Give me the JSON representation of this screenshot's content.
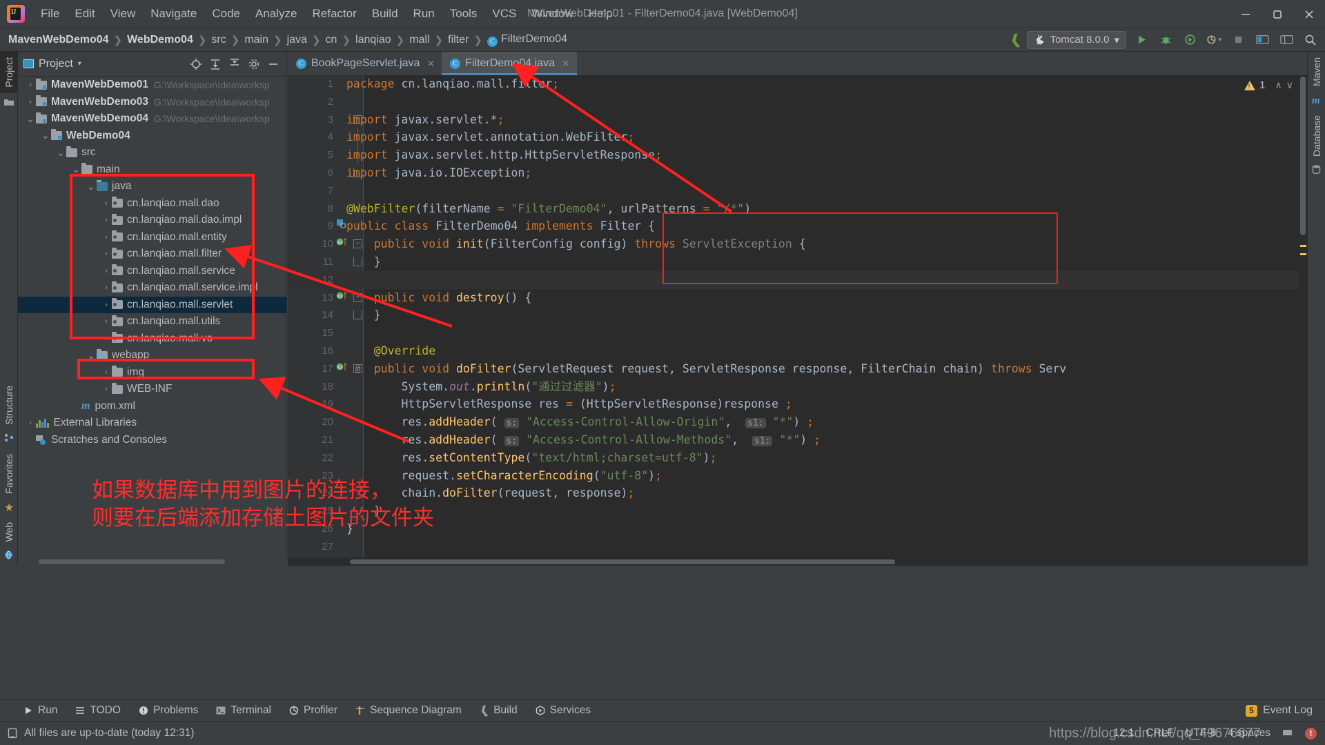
{
  "titlebar": {
    "window_title": "MavenWebDemo01 - FilterDemo04.java [WebDemo04]",
    "menus": [
      "File",
      "Edit",
      "View",
      "Navigate",
      "Code",
      "Analyze",
      "Refactor",
      "Build",
      "Run",
      "Tools",
      "VCS",
      "Window",
      "Help"
    ],
    "minimize_label": "—",
    "maximize_label": "❐",
    "close_label": "✕"
  },
  "navbar": {
    "crumbs": [
      "MavenWebDemo04",
      "WebDemo04",
      "src",
      "main",
      "java",
      "cn",
      "lanqiao",
      "mall",
      "filter",
      "FilterDemo04"
    ],
    "class_icon_letter": "C",
    "run_config": "Tomcat 8.0.0",
    "run_config_caret": "▾"
  },
  "left_strip": {
    "top_tabs": [
      "Project"
    ],
    "bottom_tabs": [
      "Structure",
      "Favorites",
      "Web"
    ]
  },
  "right_strip": {
    "tabs": [
      "Maven",
      "Database"
    ]
  },
  "project_panel": {
    "title": "Project",
    "caret": "▾",
    "tree": [
      {
        "depth": 0,
        "arrow": "›",
        "icon": "module",
        "label": "MavenWebDemo01",
        "bold": true,
        "path": "G:\\Workspace\\Idea\\worksp",
        "selected": false
      },
      {
        "depth": 0,
        "arrow": "›",
        "icon": "module",
        "label": "MavenWebDemo03",
        "bold": true,
        "path": "G:\\Workspace\\Idea\\worksp",
        "selected": false
      },
      {
        "depth": 0,
        "arrow": "⌄",
        "icon": "module",
        "label": "MavenWebDemo04",
        "bold": true,
        "path": "G:\\Workspace\\Idea\\worksp",
        "selected": false
      },
      {
        "depth": 1,
        "arrow": "⌄",
        "icon": "module",
        "label": "WebDemo04",
        "bold": true,
        "path": "",
        "selected": false
      },
      {
        "depth": 2,
        "arrow": "⌄",
        "icon": "folder",
        "label": "src",
        "bold": false,
        "path": "",
        "selected": false
      },
      {
        "depth": 3,
        "arrow": "⌄",
        "icon": "folder",
        "label": "main",
        "bold": false,
        "path": "",
        "selected": false
      },
      {
        "depth": 4,
        "arrow": "⌄",
        "icon": "source",
        "label": "java",
        "bold": false,
        "path": "",
        "selected": false
      },
      {
        "depth": 5,
        "arrow": "›",
        "icon": "package",
        "label": "cn.lanqiao.mall.dao",
        "bold": false,
        "path": "",
        "selected": false
      },
      {
        "depth": 5,
        "arrow": "›",
        "icon": "package",
        "label": "cn.lanqiao.mall.dao.impl",
        "bold": false,
        "path": "",
        "selected": false
      },
      {
        "depth": 5,
        "arrow": "›",
        "icon": "package",
        "label": "cn.lanqiao.mall.entity",
        "bold": false,
        "path": "",
        "selected": false
      },
      {
        "depth": 5,
        "arrow": "›",
        "icon": "package",
        "label": "cn.lanqiao.mall.filter",
        "bold": false,
        "path": "",
        "selected": false
      },
      {
        "depth": 5,
        "arrow": "›",
        "icon": "package",
        "label": "cn.lanqiao.mall.service",
        "bold": false,
        "path": "",
        "selected": false
      },
      {
        "depth": 5,
        "arrow": "›",
        "icon": "package",
        "label": "cn.lanqiao.mall.service.impl",
        "bold": false,
        "path": "",
        "selected": false
      },
      {
        "depth": 5,
        "arrow": "›",
        "icon": "package",
        "label": "cn.lanqiao.mall.servlet",
        "bold": false,
        "path": "",
        "selected": true
      },
      {
        "depth": 5,
        "arrow": "›",
        "icon": "package",
        "label": "cn.lanqiao.mall.utils",
        "bold": false,
        "path": "",
        "selected": false
      },
      {
        "depth": 5,
        "arrow": "›",
        "icon": "package",
        "label": "cn.lanqiao.mall.vo",
        "bold": false,
        "path": "",
        "selected": false
      },
      {
        "depth": 4,
        "arrow": "⌄",
        "icon": "webapp",
        "label": "webapp",
        "bold": false,
        "path": "",
        "selected": false
      },
      {
        "depth": 5,
        "arrow": "›",
        "icon": "folder",
        "label": "img",
        "bold": false,
        "path": "",
        "selected": false
      },
      {
        "depth": 5,
        "arrow": "›",
        "icon": "folder",
        "label": "WEB-INF",
        "bold": false,
        "path": "",
        "selected": false
      },
      {
        "depth": 3,
        "arrow": "",
        "icon": "maven",
        "label": "pom.xml",
        "bold": false,
        "path": "",
        "selected": false
      },
      {
        "depth": 0,
        "arrow": "›",
        "icon": "library",
        "label": "External Libraries",
        "bold": false,
        "path": "",
        "selected": false
      },
      {
        "depth": 0,
        "arrow": "",
        "icon": "scratch",
        "label": "Scratches and Consoles",
        "bold": false,
        "path": "",
        "selected": false
      }
    ]
  },
  "editor": {
    "tabs": [
      {
        "label": "BookPageServlet.java",
        "active": false,
        "icon_letter": "C",
        "close": "✕"
      },
      {
        "label": "FilterDemo04.java",
        "active": true,
        "icon_letter": "C",
        "close": "✕"
      }
    ],
    "warning_count": "1",
    "warning_up": "∧",
    "warning_down": "∨",
    "lines": [
      {
        "n": "1",
        "text": "package cn.lanqiao.mall.filter;"
      },
      {
        "n": "2",
        "text": ""
      },
      {
        "n": "3",
        "text": "import javax.servlet.*;"
      },
      {
        "n": "4",
        "text": "import javax.servlet.annotation.WebFilter;"
      },
      {
        "n": "5",
        "text": "import javax.servlet.http.HttpServletResponse;"
      },
      {
        "n": "6",
        "text": "import java.io.IOException;"
      },
      {
        "n": "7",
        "text": ""
      },
      {
        "n": "8",
        "text": "@WebFilter(filterName = \"FilterDemo04\", urlPatterns = \"/*\")"
      },
      {
        "n": "9",
        "text": "public class FilterDemo04 implements Filter {"
      },
      {
        "n": "10",
        "text": "    public void init(FilterConfig config) throws ServletException {"
      },
      {
        "n": "11",
        "text": "    }"
      },
      {
        "n": "12",
        "text": ""
      },
      {
        "n": "13",
        "text": "    public void destroy() {"
      },
      {
        "n": "14",
        "text": "    }"
      },
      {
        "n": "15",
        "text": ""
      },
      {
        "n": "16",
        "text": "    @Override"
      },
      {
        "n": "17",
        "text": "    public void doFilter(ServletRequest request, ServletResponse response, FilterChain chain) throws Serv"
      },
      {
        "n": "18",
        "text": "        System.out.println(\"通过过滤器\");"
      },
      {
        "n": "19",
        "text": "        HttpServletResponse res = (HttpServletResponse)response ;"
      },
      {
        "n": "20",
        "text": "        res.addHeader( s: \"Access-Control-Allow-Origin\",  s1: \"*\") ;"
      },
      {
        "n": "21",
        "text": "        res.addHeader( s: \"Access-Control-Allow-Methods\",  s1: \"*\") ;"
      },
      {
        "n": "22",
        "text": "        res.setContentType(\"text/html;charset=utf-8\");"
      },
      {
        "n": "23",
        "text": "        request.setCharacterEncoding(\"utf-8\");"
      },
      {
        "n": "24",
        "text": "        chain.doFilter(request, response);"
      },
      {
        "n": "25",
        "text": "    }"
      },
      {
        "n": "26",
        "text": "}"
      },
      {
        "n": "27",
        "text": ""
      }
    ]
  },
  "bottom_toolbar": {
    "buttons": [
      "Run",
      "TODO",
      "Problems",
      "Terminal",
      "Profiler",
      "Sequence Diagram",
      "Build",
      "Services"
    ],
    "event_log": "Event Log",
    "event_log_badge": "5"
  },
  "statusbar": {
    "message": "All files are up-to-date (today 12:31)",
    "caret_position": "12:1",
    "line_separator": "CRLF",
    "encoding": "UTF-8",
    "indent": "4 spaces",
    "error_badge": "!"
  },
  "annotations": {
    "note_line1": "如果数据库中用到图片的连接，",
    "note_line2": "则要在后端添加存储土图片的文件夹",
    "accent_red": "#ff2d2d",
    "watermark": "https://blog.csdn.net/qq_49676677"
  }
}
